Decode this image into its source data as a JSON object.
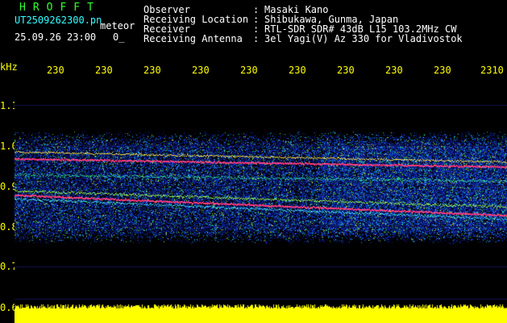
{
  "brand": "HROFFT",
  "file_name": "UT2509262300.pn",
  "meteor_label": "meteor",
  "datetime": "25.09.26 23:00",
  "count_text": "0_",
  "info": [
    {
      "label": "Observer",
      "value": "Masaki Kano"
    },
    {
      "label": "Receiving Location",
      "value": "Shibukawa, Gunma, Japan"
    },
    {
      "label": "Receiver",
      "value": "RTL-SDR SDR# 43dB L15 103.2MHz CW"
    },
    {
      "label": "Receiving Antenna",
      "value": "3el Yagi(V) Az 330 for Vladivostok"
    }
  ],
  "axis": {
    "y_unit": "kHz",
    "y_ticks": [
      "1.1",
      "1.0",
      "0.9",
      "0.8",
      "0.7",
      "0.6"
    ],
    "x_ticks": [
      "230",
      "230",
      "230",
      "230",
      "230",
      "230",
      "230",
      "230",
      "230",
      "2310"
    ]
  },
  "colors": {
    "text_green": "#33ff33",
    "text_yellow": "#ffff00",
    "text_white": "#ffffff",
    "background": "#000000"
  }
}
